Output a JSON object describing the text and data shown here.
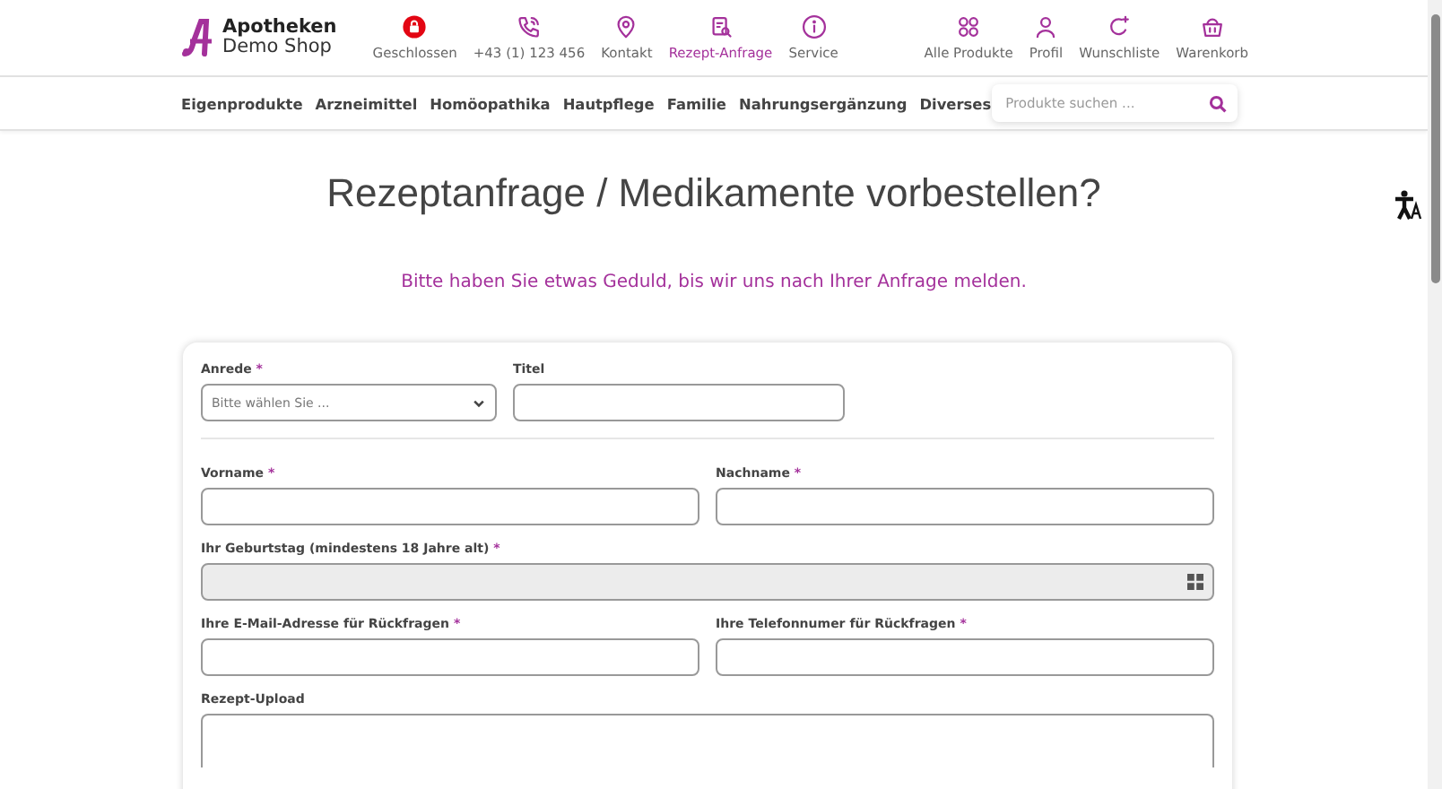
{
  "logo": {
    "line1": "Apotheken",
    "line2": "Demo Shop"
  },
  "header_links": [
    {
      "kind": "closed",
      "label": "Geschlossen",
      "selected": false
    },
    {
      "kind": "phone",
      "label": "+43 (1) 123 456",
      "selected": false
    },
    {
      "kind": "location",
      "label": "Kontakt",
      "selected": false
    },
    {
      "kind": "prescription",
      "label": "Rezept-Anfrage",
      "selected": true
    },
    {
      "kind": "info",
      "label": "Service",
      "selected": false
    }
  ],
  "header_actions": [
    {
      "kind": "grid",
      "label": "Alle Produkte"
    },
    {
      "kind": "person",
      "label": "Profil"
    },
    {
      "kind": "wishlist",
      "label": "Wunschliste"
    },
    {
      "kind": "basket",
      "label": "Warenkorb"
    }
  ],
  "categories": [
    "Eigenprodukte",
    "Arzneimittel",
    "Homöopathika",
    "Hautpflege",
    "Familie",
    "Nahrungsergänzung",
    "Diverses"
  ],
  "search": {
    "placeholder": "Produkte suchen ..."
  },
  "title": "Rezeptanfrage / Medikamente vorbestellen?",
  "subtitle": "Bitte haben Sie etwas Geduld, bis wir uns nach Ihrer Anfrage melden.",
  "required_mark": "*",
  "form_rows": [
    {
      "kind": "fields",
      "fields": [
        {
          "label": "Anrede",
          "required": true,
          "kind": "select",
          "placeholder": "Bitte wählen Sie ..."
        },
        {
          "label": "Titel",
          "required": false,
          "kind": "text"
        }
      ]
    },
    {
      "kind": "divider"
    },
    {
      "kind": "fields",
      "fields": [
        {
          "label": "Vorname",
          "required": true,
          "kind": "text"
        },
        {
          "label": "Nachname",
          "required": true,
          "kind": "text"
        }
      ]
    },
    {
      "kind": "fields",
      "fields": [
        {
          "label": "Ihr Geburtstag (mindestens 18 Jahre alt)",
          "required": true,
          "kind": "date",
          "disabled": true
        }
      ]
    },
    {
      "kind": "fields",
      "fields": [
        {
          "label": "Ihre E-Mail-Adresse für Rückfragen",
          "required": true,
          "kind": "text"
        },
        {
          "label": "Ihre Telefonnumer für Rückfragen",
          "required": true,
          "kind": "text"
        }
      ]
    },
    {
      "kind": "fields",
      "fields": [
        {
          "label": "Rezept-Upload",
          "required": false,
          "kind": "upload"
        }
      ]
    }
  ]
}
